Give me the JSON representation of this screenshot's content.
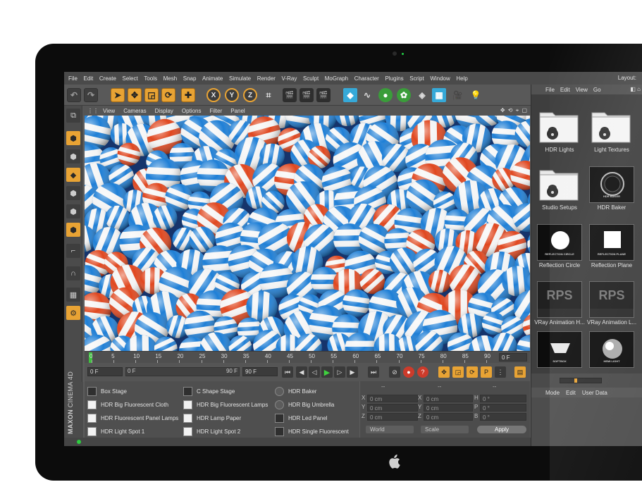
{
  "menu": [
    "File",
    "Edit",
    "Create",
    "Select",
    "Tools",
    "Mesh",
    "Snap",
    "Animate",
    "Simulate",
    "Render",
    "V-Ray",
    "Sculpt",
    "MoGraph",
    "Character",
    "Plugins",
    "Script",
    "Window",
    "Help"
  ],
  "layout_label": "Layout:",
  "toolbar": {
    "x_label": "X",
    "y_label": "Y",
    "z_label": "Z"
  },
  "viewport_menu": [
    "View",
    "Cameras",
    "Display",
    "Options",
    "Filter",
    "Panel"
  ],
  "timeline": {
    "ticks": [
      "0",
      "5",
      "10",
      "15",
      "20",
      "25",
      "30",
      "35",
      "40",
      "45",
      "50",
      "55",
      "60",
      "65",
      "70",
      "75",
      "80",
      "85",
      "90"
    ],
    "frame_field": "0 F"
  },
  "transport": {
    "start_frame": "0 F",
    "min_frame": "0 F",
    "max_frame": "90 F",
    "end_frame": "90 F"
  },
  "branding": {
    "vendor": "MAXON",
    "product": "CINEMA 4D"
  },
  "objects": {
    "col1": [
      "Box Stage",
      "HDR Big Fluorescent Cloth",
      "HDR Fluorescent Panel Lamps",
      "HDR Light Spot 1"
    ],
    "col2": [
      "C Shape Stage",
      "HDR Big Fluorescent Lamps",
      "HDR Lamp Paper",
      "HDR Light Spot 2"
    ],
    "col3": [
      "HDR Baker",
      "HDR Big Umbrella",
      "HDR Led Panel",
      "HDR Single Fluorescent"
    ]
  },
  "coordinates": {
    "headers": [
      "--",
      "--",
      "--"
    ],
    "rows": [
      {
        "axis": "X",
        "pos": "0 cm",
        "axis2": "X",
        "size": "0 cm",
        "rot_axis": "H",
        "rot": "0 °"
      },
      {
        "axis": "Y",
        "pos": "0 cm",
        "axis2": "Y",
        "size": "0 cm",
        "rot_axis": "P",
        "rot": "0 °"
      },
      {
        "axis": "Z",
        "pos": "0 cm",
        "axis2": "Z",
        "size": "0 cm",
        "rot_axis": "B",
        "rot": "0 °"
      }
    ],
    "space_select": "World",
    "mode_select": "Scale",
    "apply_label": "Apply"
  },
  "browser": {
    "menu": [
      "File",
      "Edit",
      "View",
      "Go"
    ],
    "tiles": [
      {
        "label": "HDR Lights",
        "kind": "folder"
      },
      {
        "label": "Light Textures",
        "kind": "folder"
      },
      {
        "label": "Studio Setups",
        "kind": "folder"
      },
      {
        "label": "HDR Baker",
        "kind": "baker",
        "caption": "HDR BAKER"
      },
      {
        "label": "Reflection Circle",
        "kind": "circle",
        "caption": "REFLECTION CIRCLE"
      },
      {
        "label": "Reflection Plane",
        "kind": "square",
        "caption": "REFLECTION PLANE"
      },
      {
        "label": "VRay Animation H...",
        "kind": "rps",
        "caption": "RPS"
      },
      {
        "label": "VRay Animation L...",
        "kind": "rps",
        "caption": "RPS"
      },
      {
        "label": "",
        "kind": "softbox",
        "caption": "SOFTBOX"
      },
      {
        "label": "",
        "kind": "sphere",
        "caption": "HEMI LIGHT"
      }
    ]
  },
  "attributes_menu": [
    "Mode",
    "Edit",
    "User Data"
  ],
  "colors": {
    "accent_orange": "#e8a334",
    "ball_blue": "#1f7fd6",
    "ball_red": "#e0471f",
    "play_green": "#3fd13f"
  }
}
